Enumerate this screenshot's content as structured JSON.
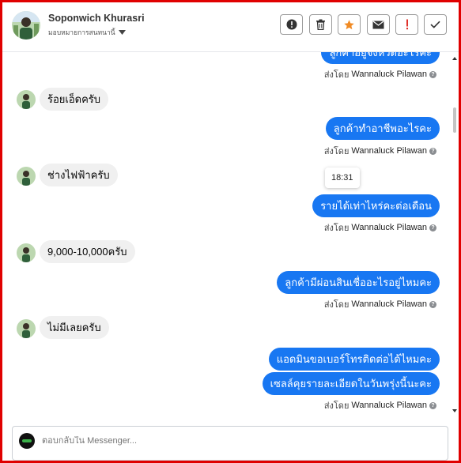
{
  "header": {
    "contact_name": "Soponwich Khurasri",
    "assign_label": "มอบหมายการสนทนานี้"
  },
  "toolbar": {
    "buttons": [
      {
        "icon": "alert-circle-icon"
      },
      {
        "icon": "trash-icon"
      },
      {
        "icon": "star-icon",
        "color": "#f08a24"
      },
      {
        "icon": "envelope-icon"
      },
      {
        "icon": "exclamation-icon",
        "color": "#e0322b"
      },
      {
        "icon": "check-icon"
      }
    ]
  },
  "messages": {
    "m0": {
      "direction": "outgoing",
      "text": "ลูกค้าอยู่จังหวัดอะไรคะ"
    },
    "m0_sent": {
      "prefix": "ส่งโดย",
      "sender": "Wannaluck Pilawan"
    },
    "m1": {
      "direction": "incoming",
      "text": "ร้อยเอ็ดครับ"
    },
    "m2": {
      "direction": "outgoing",
      "text": "ลูกค้าทำอาชีพอะไรคะ"
    },
    "m2_sent": {
      "prefix": "ส่งโดย",
      "sender": "Wannaluck Pilawan"
    },
    "m3": {
      "direction": "incoming",
      "text": "ช่างไฟฟ้าครับ"
    },
    "timestamp": "18:31",
    "m4": {
      "direction": "outgoing",
      "text": "รายได้เท่าไหร่คะต่อเดือน"
    },
    "m4_sent": {
      "prefix": "ส่งโดย",
      "sender": "Wannaluck Pilawan"
    },
    "m5": {
      "direction": "incoming",
      "text": "9,000-10,000ครับ"
    },
    "m6": {
      "direction": "outgoing",
      "text": "ลูกค้ามีผ่อนสินเชื่ออะไรอยู่ไหมคะ"
    },
    "m6_sent": {
      "prefix": "ส่งโดย",
      "sender": "Wannaluck Pilawan"
    },
    "m7": {
      "direction": "incoming",
      "text": "ไม่มีเลยครับ"
    },
    "m8": {
      "direction": "outgoing",
      "text": "แอดมินขอเบอร์โทรติดต่อได้ไหมคะ"
    },
    "m9": {
      "direction": "outgoing",
      "text": "เซลล์คุยรายละเอียดในวันพรุ่งนี้นะคะ"
    },
    "m9_sent": {
      "prefix": "ส่งโดย",
      "sender": "Wannaluck Pilawan"
    }
  },
  "composer": {
    "placeholder": "ตอบกลับใน Messenger..."
  },
  "colors": {
    "outgoing_bubble": "#1877f2",
    "incoming_bubble": "#f0f0f0",
    "frame_border": "#e00000"
  }
}
